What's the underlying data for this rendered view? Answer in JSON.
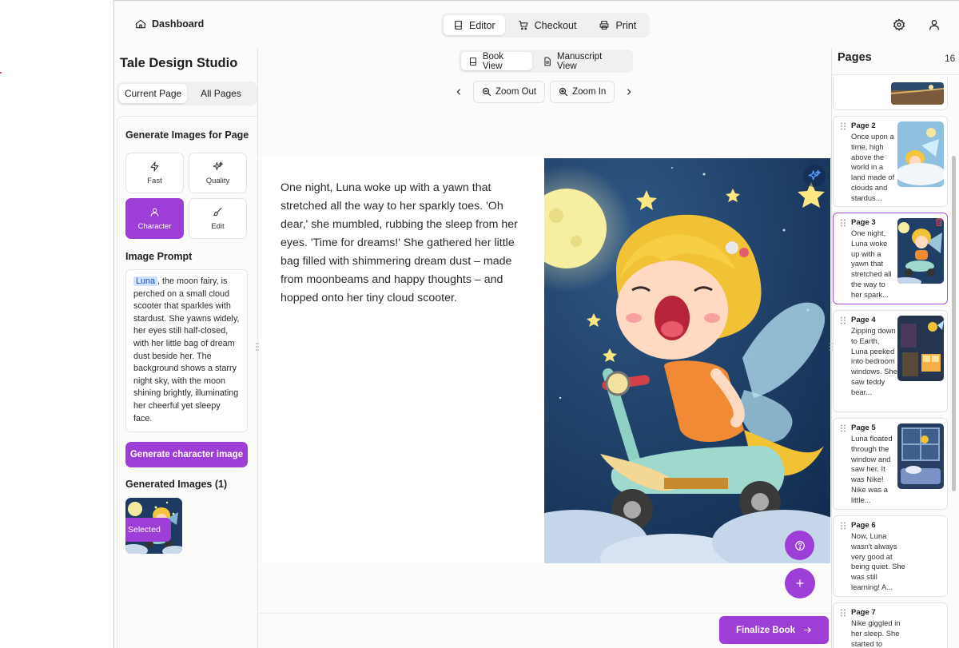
{
  "header": {
    "dashboard_label": "Dashboard",
    "tabs": [
      {
        "label": "Editor",
        "icon": "book-icon",
        "active": true
      },
      {
        "label": "Checkout",
        "icon": "cart-icon",
        "active": false
      },
      {
        "label": "Print",
        "icon": "printer-icon",
        "active": false
      }
    ],
    "right_icons": [
      "gear-icon",
      "user-icon"
    ]
  },
  "left_panel": {
    "title": "Tale Design Studio",
    "page_tabs": [
      {
        "label": "Current Page",
        "active": true
      },
      {
        "label": "All Pages",
        "active": false
      }
    ],
    "generate_title": "Generate Images for Page",
    "modes": [
      {
        "label": "Fast",
        "icon": "zap-icon",
        "active": false
      },
      {
        "label": "Quality",
        "icon": "sparkles-icon",
        "active": false
      },
      {
        "label": "Character",
        "icon": "user-icon",
        "active": true
      },
      {
        "label": "Edit",
        "icon": "brush-icon",
        "active": false
      }
    ],
    "prompt_label": "Image Prompt",
    "prompt_highlight": "Luna",
    "prompt_text": ", the moon fairy, is perched on a small cloud scooter that sparkles with stardust. She yawns widely, her eyes still half-closed, with her little bag of dream dust beside her. The background shows a starry night sky, with the moon shining brightly, illuminating her cheerful yet sleepy face.",
    "generate_button": "Generate character image",
    "generated_label": "Generated Images (1)",
    "selected_badge": "Selected"
  },
  "center": {
    "view_tabs": [
      {
        "label": "Book View",
        "icon": "book-icon",
        "active": true
      },
      {
        "label": "Manuscript View",
        "icon": "document-icon",
        "active": false
      }
    ],
    "zoom_out": "Zoom Out",
    "zoom_in": "Zoom In",
    "story_text": "One night, Luna woke up with a yawn that stretched all the way to her sparkly toes. 'Oh dear,' she mumbled, rubbing the sleep from her eyes. 'Time for dreams!' She gathered her little bag filled with shimmering dream dust – made from moonbeams and happy thoughts – and hopped onto her tiny cloud scooter.",
    "finalize_button": "Finalize Book"
  },
  "right_panel": {
    "title": "Pages",
    "count": "16",
    "pages": [
      {
        "title": "Page 2",
        "desc": "Once upon a time, high above the world in a land made of clouds and stardus..."
      },
      {
        "title": "Page 3",
        "desc": "One night, Luna woke up with a yawn that stretched all the way to her spark...",
        "active": true
      },
      {
        "title": "Page 4",
        "desc": "Zipping down to Earth, Luna peeked into bedroom windows. She saw teddy bear..."
      },
      {
        "title": "Page 5",
        "desc": "Luna floated through the window and saw her. It was Nike! Nike was a little..."
      },
      {
        "title": "Page 6",
        "desc": "Now, Luna wasn't always very good at being quiet. She was still learning! A..."
      },
      {
        "title": "Page 7",
        "desc": "Nike giggled in her sleep. She started to"
      }
    ]
  },
  "colors": {
    "accent": "#9d3fd6",
    "highlight": "#cfe2ff",
    "background": "#fbfbfa"
  }
}
